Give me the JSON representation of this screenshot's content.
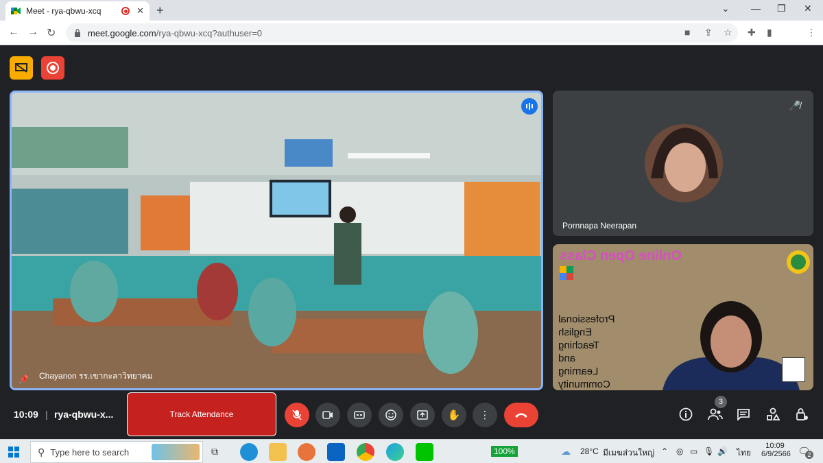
{
  "browser": {
    "tab_title": "Meet - rya-qbwu-xcq",
    "url_host": "meet.google.com",
    "url_path": "/rya-qbwu-xcq?authuser=0"
  },
  "meeting": {
    "time": "10:09",
    "separator": "|",
    "code": "rya-qbwu-x...",
    "track_attendance_label": "Track Attendance",
    "participants_badge": "3"
  },
  "tiles": {
    "main_name": "Chayanon รร.เขากะลาวิทยาคม",
    "side1_name": "Pornnapa Neerapan",
    "slide_title": "Online Open Class",
    "slide_lines": [
      "Professional",
      "English",
      "Teaching",
      "and",
      "Learning",
      "Community"
    ]
  },
  "taskbar": {
    "search_placeholder": "Type here to search",
    "battery": "100%",
    "weather_temp": "28°C",
    "weather_text": "มีเมฆส่วนใหญ่",
    "lang": "ไทย",
    "clock_time": "10:09",
    "clock_date": "6/9/2566",
    "notif_count": "2"
  },
  "colors": {
    "meet_bg": "#202124",
    "accent_blue": "#8ab4f8",
    "danger_red": "#ea4335",
    "attendance_red": "#c5221f",
    "present_yellow": "#f9ab00"
  }
}
